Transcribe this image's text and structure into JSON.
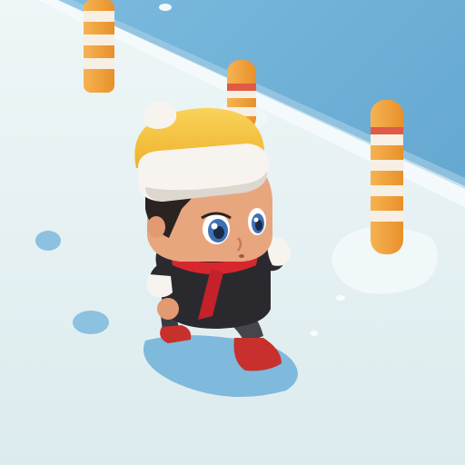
{
  "scene": {
    "name": "snowy-runner-gameplay",
    "colors": {
      "water": "#6fb0d6",
      "water_deep": "#5a9fc9",
      "snow": "#e6f1f3",
      "snow_shadow": "#c9e2ea",
      "footprint": "#7fb9dc",
      "pole_orange": "#f3a23c",
      "pole_white": "#f7efe4",
      "pole_red": "#e05a45",
      "hat_yellow": "#f6c23a",
      "hat_white": "#f7f4ef",
      "jacket": "#2a2a2e",
      "scarf": "#d8262f",
      "skin": "#e29a72",
      "hair": "#2b2320",
      "eye": "#3f6fb5",
      "shoe": "#c8302d"
    },
    "objects": {
      "poles": [
        "boundary-pole-left",
        "boundary-pole-middle",
        "boundary-pole-right"
      ],
      "character": "player-character"
    }
  }
}
